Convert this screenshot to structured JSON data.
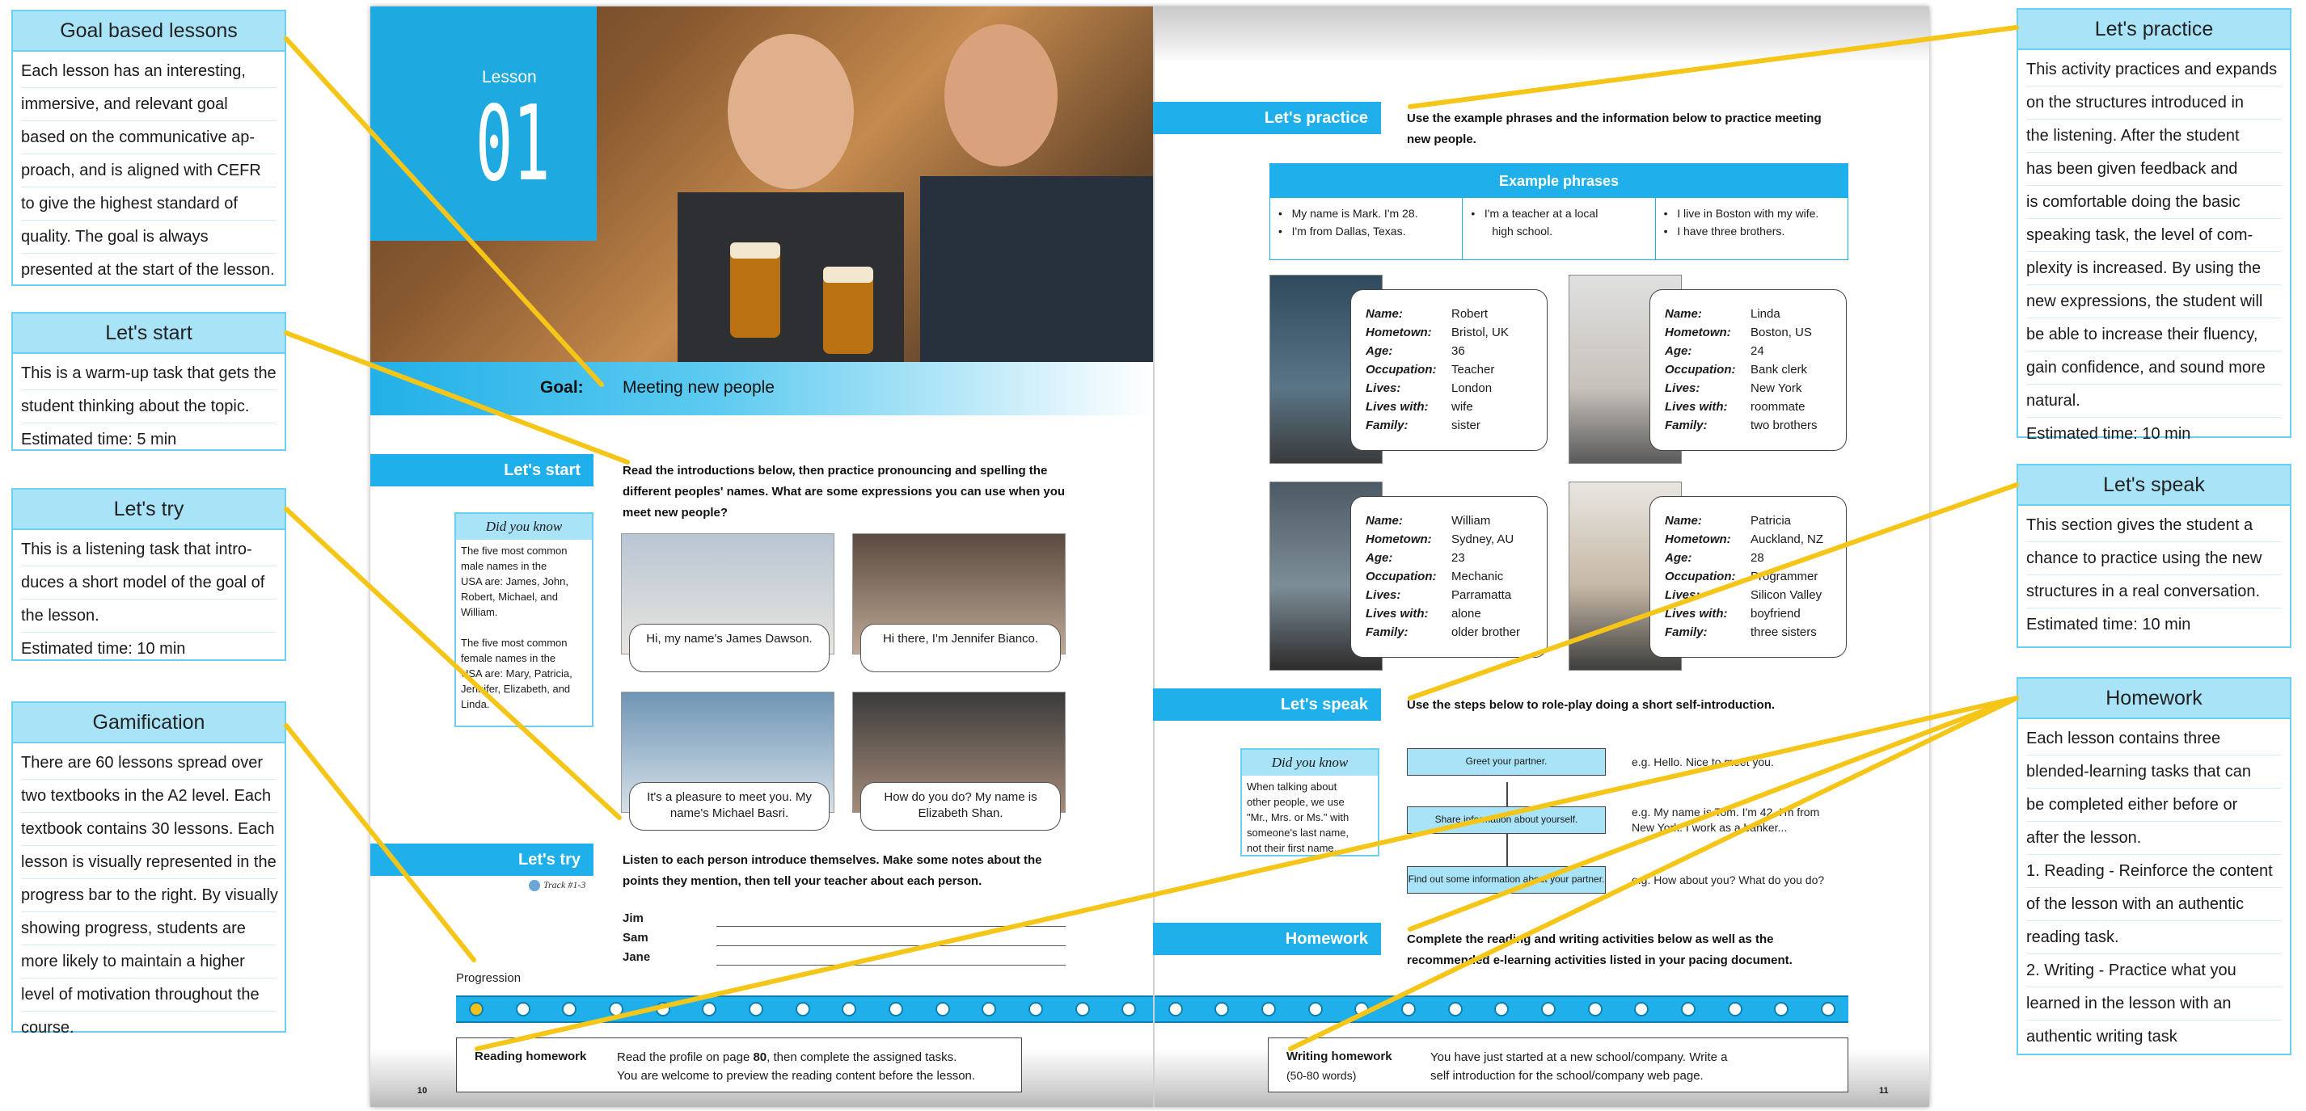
{
  "notes": {
    "goal": {
      "title": "Goal based lessons",
      "lines": [
        "Each lesson has an interesting,",
        "immersive, and relevant goal",
        "based on the communicative ap-",
        "proach, and is aligned with CEFR",
        "to give the highest standard of",
        "quality. The goal is always",
        "presented at the start of the lesson."
      ]
    },
    "start": {
      "title": "Let's start",
      "lines": [
        "This is a warm-up task that gets the",
        "student thinking about the topic.",
        "Estimated time: 5 min"
      ]
    },
    "try": {
      "title": "Let's try",
      "lines": [
        "This is a listening task that intro-",
        "duces a short model of the goal of",
        "the lesson.",
        "Estimated time: 10 min"
      ]
    },
    "gamification": {
      "title": "Gamification",
      "lines": [
        "There are 60 lessons spread over",
        "two textbooks in the A2 level. Each",
        "textbook contains 30 lessons. Each",
        "lesson is visually represented in the",
        "progress bar to the right. By visually",
        "showing progress, students are",
        "more likely to maintain a higher",
        "level of motivation throughout the",
        "course."
      ]
    },
    "practice": {
      "title": "Let's practice",
      "lines": [
        "This activity practices and expands",
        "on the structures introduced in",
        "the listening. After the student",
        "has been given feedback and",
        "is comfortable doing the basic",
        "speaking task, the level of com-",
        "plexity is increased. By using the",
        "new expressions, the student will",
        "be able to increase their fluency,",
        "gain confidence, and sound more",
        "natural.",
        "Estimated time: 10 min"
      ]
    },
    "speak": {
      "title": "Let's speak",
      "lines": [
        "This section gives the student a",
        "chance to practice using the new",
        "structures in a real conversation.",
        "Estimated time: 10 min"
      ]
    },
    "homework": {
      "title": "Homework",
      "lines": [
        "Each lesson contains three",
        "blended-learning tasks that can",
        "be completed either before or",
        "after the lesson.",
        "1. Reading - Reinforce the content",
        "of the lesson with an authentic",
        "reading task.",
        "2. Writing - Practice what you",
        "learned in the lesson with an",
        "authentic writing task"
      ]
    }
  },
  "book": {
    "lesson_label": "Lesson",
    "lesson_number": "01",
    "goal_label": "Goal:",
    "goal_text": "Meeting new people",
    "start": {
      "label": "Let's start",
      "instruction": [
        "Read the introductions below, then practice pronouncing and spelling the",
        "different peoples' names. What are some expressions you can use when you",
        "meet new people?"
      ]
    },
    "dyk1": {
      "title": "Did you know",
      "text": [
        "The five most common",
        "male names in the",
        "USA are: James, John,",
        "Robert, Michael, and",
        "William.",
        "",
        "The five most common",
        "female names in the",
        "USA are: Mary, Patricia,",
        "Jennifer, Elizabeth, and",
        "Linda."
      ]
    },
    "bubbles": [
      "Hi, my name's James Dawson.",
      "Hi there, I'm Jennifer Bianco.",
      "It's a pleasure to meet you. My name's Michael Basri.",
      "How do you do?  My name is Elizabeth Shan."
    ],
    "try": {
      "label": "Let's try",
      "track": "Track #1-3",
      "instruction": [
        "Listen to each person introduce themselves. Make some notes about the",
        "points they mention, then tell your teacher about each person."
      ],
      "names": [
        "Jim",
        "Sam",
        "Jane"
      ]
    },
    "progression_label": "Progression",
    "progress": {
      "total": 30,
      "completed": 1
    },
    "reading_hw": {
      "title": "Reading homework",
      "text_before": "Read the profile on page ",
      "page": "80",
      "text_after": ", then complete the assigned tasks.",
      "line2": "You are welcome to preview the reading content before the lesson."
    },
    "writing_hw": {
      "title": "Writing homework",
      "words": "(50-80 words)",
      "line1": "You have just started at a new school/company. Write a",
      "line2": "self introduction for the school/company web page."
    },
    "page_left": "10",
    "page_right": "11",
    "practice": {
      "label": "Let's practice",
      "instruction": [
        "Use the example phrases and the information below to practice meeting",
        "new people."
      ]
    },
    "phrases": {
      "title": "Example phrases",
      "col1": [
        "My name is Mark. I'm 28.",
        "I'm from Dallas, Texas."
      ],
      "col2": [
        "I'm a teacher at a local",
        "high school."
      ],
      "col3": [
        "I live in Boston with my wife.",
        "I have three brothers."
      ]
    },
    "profile_keys": [
      "Name:",
      "Hometown:",
      "Age:",
      "Occupation:",
      "Lives:",
      "Lives with:",
      "Family:"
    ],
    "profiles": [
      [
        "Robert",
        "Bristol, UK",
        "36",
        "Teacher",
        "London",
        "wife",
        "sister"
      ],
      [
        "Linda",
        "Boston, US",
        "24",
        "Bank clerk",
        "New York",
        "roommate",
        "two brothers"
      ],
      [
        "William",
        "Sydney, AU",
        "23",
        "Mechanic",
        "Parramatta",
        "alone",
        "older brother"
      ],
      [
        "Patricia",
        "Auckland, NZ",
        "28",
        "Programmer",
        "Silicon Valley",
        "boyfriend",
        "three sisters"
      ]
    ],
    "speak": {
      "label": "Let's speak",
      "instruction": "Use the steps below to role-play doing a short self-introduction."
    },
    "dyk2": {
      "title": "Did you know",
      "text": [
        "When talking about",
        "other people, we use",
        "\"Mr., Mrs. or Ms.\" with",
        "someone's last name,",
        "not their first name."
      ]
    },
    "steps": [
      "Greet your partner.",
      "Share information about yourself.",
      "Find out some information about your partner."
    ],
    "step_examples": [
      [
        "e.g. Hello. Nice to meet you."
      ],
      [
        "e.g. My name is Tom. I'm 42. I'm from",
        "New York. I work as a banker..."
      ],
      [
        "e.g. How about you? What do you do?"
      ]
    ],
    "hw": {
      "label": "Homework",
      "instruction": [
        "Complete the reading and writing activities below as well as the",
        "recommended e-learning activities listed in your pacing document."
      ]
    }
  },
  "colors": {
    "accent": "#1fb0ec",
    "note_border": "#6ccfef",
    "note_header": "#a9e3f7",
    "pointer": "#f5c518"
  }
}
